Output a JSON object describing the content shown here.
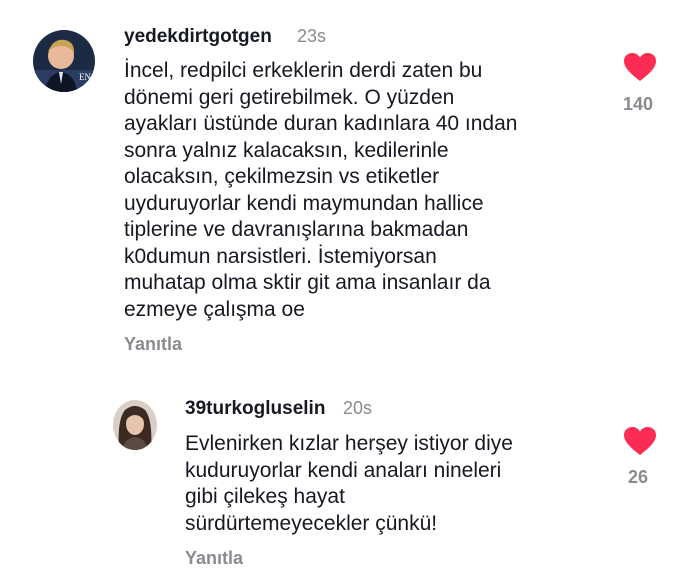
{
  "comments": [
    {
      "username": "yedekdirtgotgen",
      "time": "23s",
      "text": "İncel, redpilci erkeklerin derdi zaten bu\ndönemi geri getirebilmek. O yüzden\nayakları üstünde duran kadınlara 40 ından\nsonra yalnız kalacaksın, kedilerinle\nolacaksın, çekilmezsin vs etiketler\nuyduruyorlar kendi maymundan hallice\ntiplerine ve davranışlarına bakmadan\nk0dumun narsistleri. İstemiyorsan\nmuhatap olma sktir git ama insanlaır da\nezmeye çalışma oe",
      "reply_label": "Yanıtla",
      "likes": "140",
      "heart_color": "#fe2c55"
    },
    {
      "username": "39turkogluselin",
      "time": "20s",
      "text": "Evlenirken kızlar herşey istiyor diye\nkuduruyorlar kendi anaları nineleri\ngibi çilekeş hayat\nsürdürtemeyecekler çünkü!",
      "reply_label": "Yanıtla",
      "likes": "26",
      "heart_color": "#fe2c55"
    }
  ],
  "avatar_badge": "EN"
}
